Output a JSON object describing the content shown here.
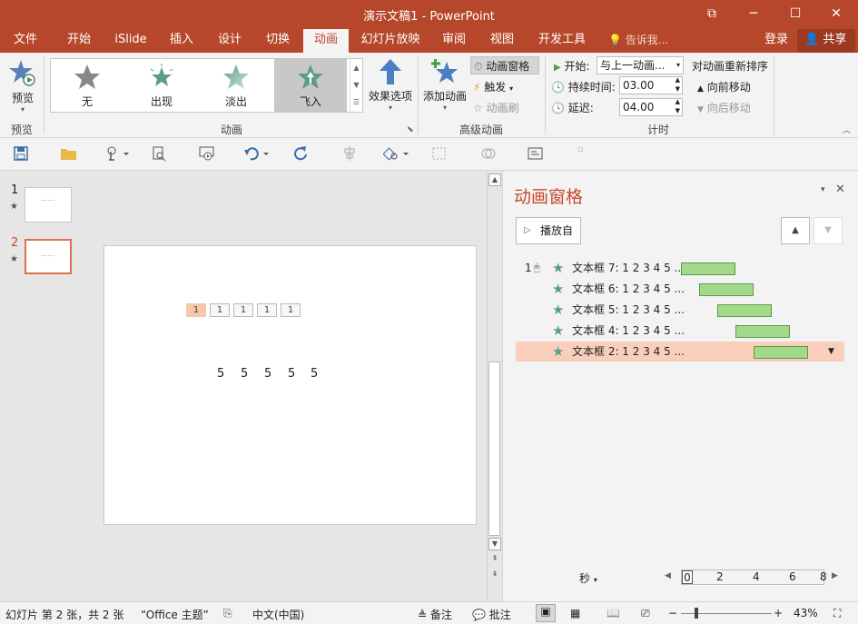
{
  "window": {
    "title": "演示文稿1 - PowerPoint",
    "btn_restore": "⧉",
    "btn_min": "─",
    "btn_max": "☐",
    "btn_close": "✕"
  },
  "tabs": [
    "文件",
    "开始",
    "iSlide",
    "插入",
    "设计",
    "切换",
    "动画",
    "幻灯片放映",
    "审阅",
    "视图",
    "开发工具"
  ],
  "tell_me": "告诉我...",
  "sign_in": "登录",
  "share": "共享",
  "ribbon": {
    "preview": {
      "label": "预览",
      "group": "预览"
    },
    "animation_gallery": {
      "items": [
        "无",
        "出现",
        "淡出",
        "飞入"
      ],
      "selected": "飞入",
      "group": "动画"
    },
    "effect_options": "效果选项",
    "advanced": {
      "add_animation": "添加动画",
      "animation_pane": "动画窗格",
      "trigger": "触发",
      "animation_painter": "动画刷",
      "group": "高级动画"
    },
    "timing": {
      "start_label": "开始:",
      "start_value": "与上一动画...",
      "duration_label": "持续时间:",
      "duration_value": "03.00",
      "delay_label": "延迟:",
      "delay_value": "04.00",
      "reorder_title": "对动画重新排序",
      "move_earlier": "向前移动",
      "move_later": "向后移动",
      "group": "计时"
    }
  },
  "thumbnails": [
    {
      "num": "1",
      "star": "★"
    },
    {
      "num": "2",
      "star": "★"
    }
  ],
  "slide": {
    "boxes": [
      "1",
      "1",
      "1",
      "1",
      "1"
    ],
    "fives": [
      "5",
      "5",
      "5",
      "5",
      "5"
    ]
  },
  "pane": {
    "title": "动画窗格",
    "play_from": "播放自",
    "rows": [
      {
        "num": "1",
        "label": "文本框 7: 1 2 3 4 5 ..."
      },
      {
        "num": "",
        "label": "文本框 6: 1 2 3 4 5 ..."
      },
      {
        "num": "",
        "label": "文本框 5: 1 2 3 4 5 ..."
      },
      {
        "num": "",
        "label": "文本框 4: 1 2 3 4 5 ..."
      },
      {
        "num": "",
        "label": "文本框 2: 1 2 3 4 5 ..."
      }
    ],
    "seconds": "秒",
    "timeline_ticks": [
      "0",
      "2",
      "4",
      "6",
      "8"
    ]
  },
  "status": {
    "slide_info": "幻灯片 第 2 张，共 2 张",
    "theme": "“Office 主题”",
    "language": "中文(中国)",
    "notes": "备注",
    "comments": "批注",
    "zoom": "43%"
  },
  "colors": {
    "accent": "#b7472a",
    "selected_row": "#f9cfbc",
    "timeline_bar": "#a3d98a"
  }
}
